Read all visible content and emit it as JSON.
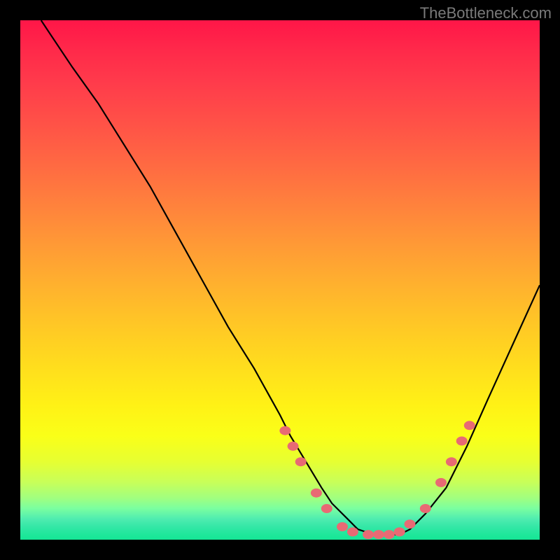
{
  "watermark": {
    "text": "TheBottleneck.com"
  },
  "chart_data": {
    "type": "line",
    "title": "",
    "xlabel": "",
    "ylabel": "",
    "xlim": [
      0,
      100
    ],
    "ylim": [
      0,
      100
    ],
    "series": [
      {
        "name": "bottleneck-curve",
        "x": [
          4,
          6,
          10,
          15,
          20,
          25,
          30,
          35,
          40,
          45,
          50,
          52,
          55,
          58,
          60,
          63,
          65,
          68,
          70,
          73,
          75,
          78,
          82,
          86,
          90,
          95,
          100
        ],
        "values": [
          100,
          97,
          91,
          84,
          76,
          68,
          59,
          50,
          41,
          33,
          24,
          20,
          15,
          10,
          7,
          4,
          2,
          1,
          1,
          1,
          2,
          5,
          10,
          18,
          27,
          38,
          49
        ]
      }
    ],
    "markers": [
      {
        "x": 51,
        "y": 21
      },
      {
        "x": 52.5,
        "y": 18
      },
      {
        "x": 54,
        "y": 15
      },
      {
        "x": 57,
        "y": 9
      },
      {
        "x": 59,
        "y": 6
      },
      {
        "x": 62,
        "y": 2.5
      },
      {
        "x": 64,
        "y": 1.5
      },
      {
        "x": 67,
        "y": 1
      },
      {
        "x": 69,
        "y": 1
      },
      {
        "x": 71,
        "y": 1
      },
      {
        "x": 73,
        "y": 1.5
      },
      {
        "x": 75,
        "y": 3
      },
      {
        "x": 78,
        "y": 6
      },
      {
        "x": 81,
        "y": 11
      },
      {
        "x": 83,
        "y": 15
      },
      {
        "x": 85,
        "y": 19
      },
      {
        "x": 86.5,
        "y": 22
      }
    ],
    "marker_color": "#e86a74",
    "curve_color": "#000000"
  }
}
